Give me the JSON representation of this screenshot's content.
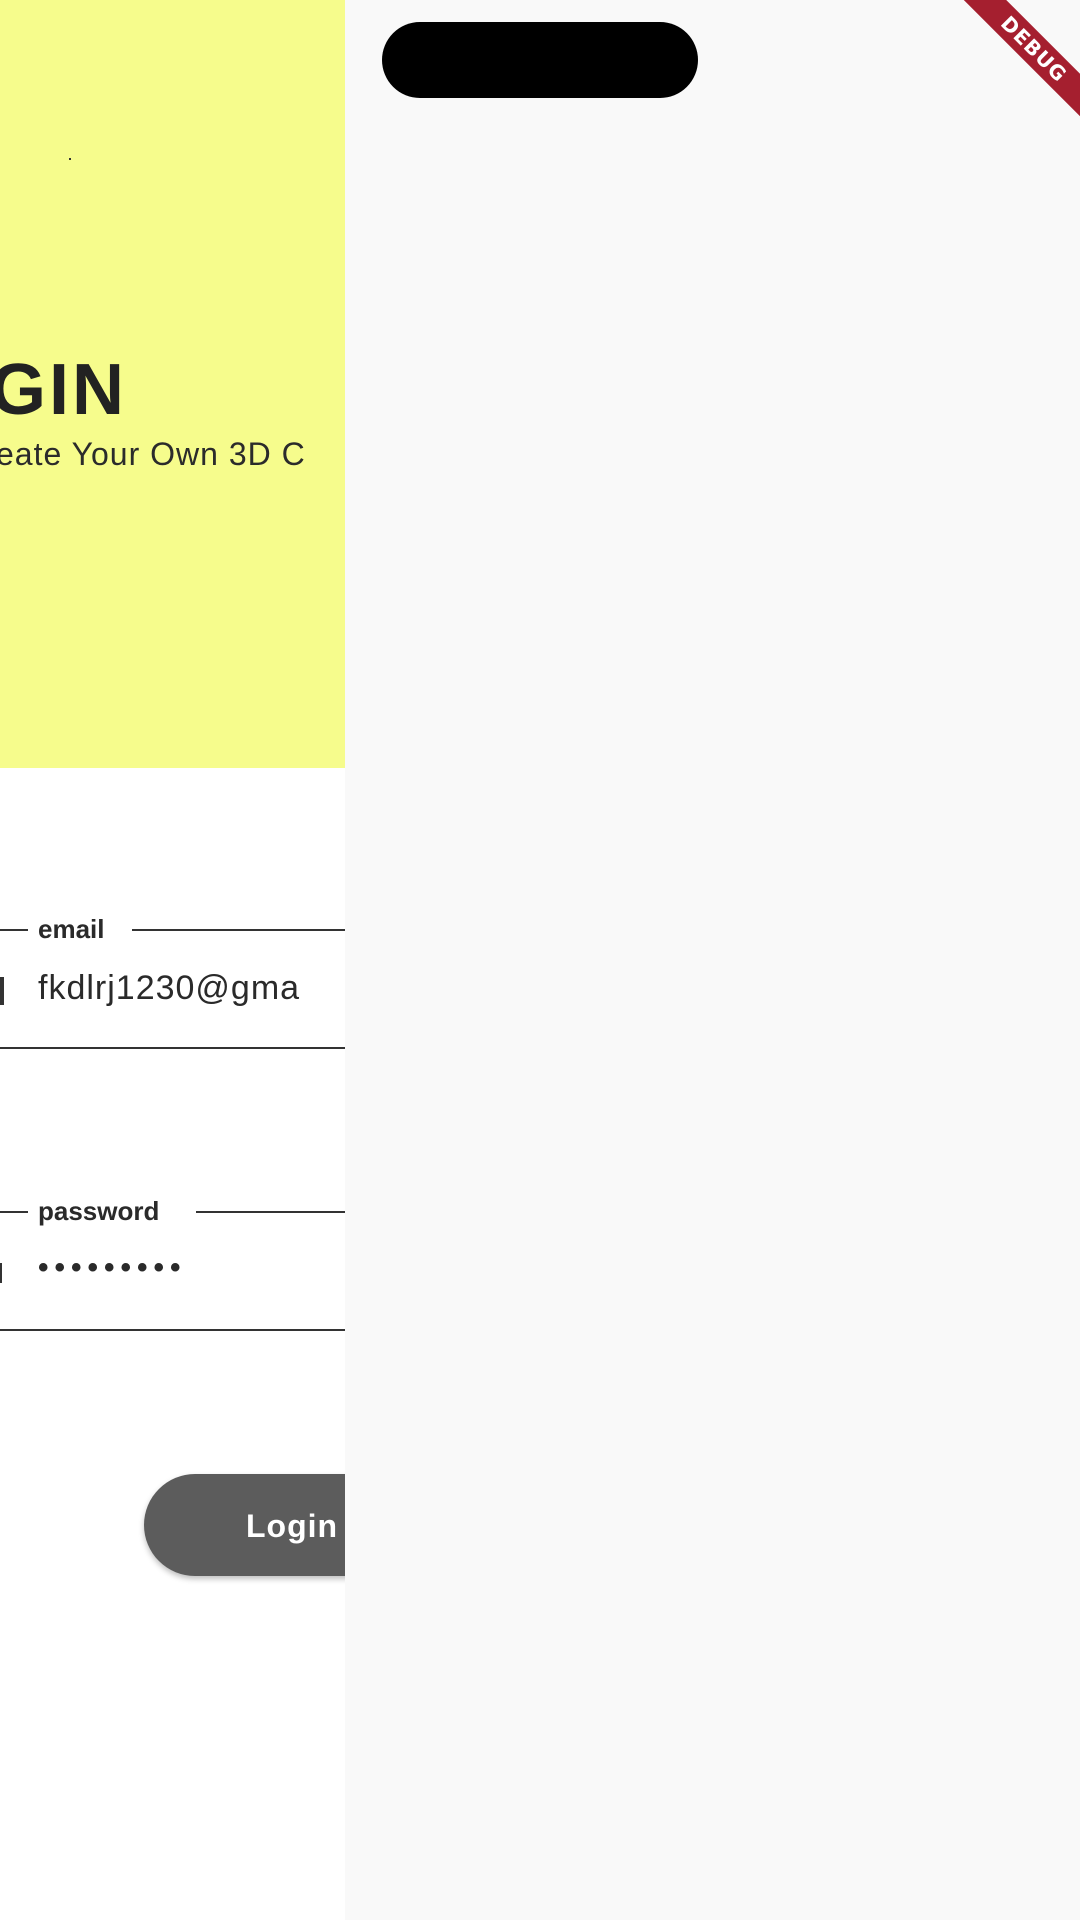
{
  "hero": {
    "title": "GIN",
    "subtitle": "eate Your Own 3D C"
  },
  "form": {
    "email": {
      "label": "email",
      "value": "fkdlrj1230@gma"
    },
    "password": {
      "label": "password",
      "value": "•••••••••"
    },
    "login_label": "Login"
  },
  "debug_banner": {
    "label": "DEBUG"
  },
  "colors": {
    "hero_background": "#f6fc8c",
    "page_background": "#f9f9f9",
    "button_background": "#5c5c5c",
    "debug_banner": "#a51f2f"
  }
}
